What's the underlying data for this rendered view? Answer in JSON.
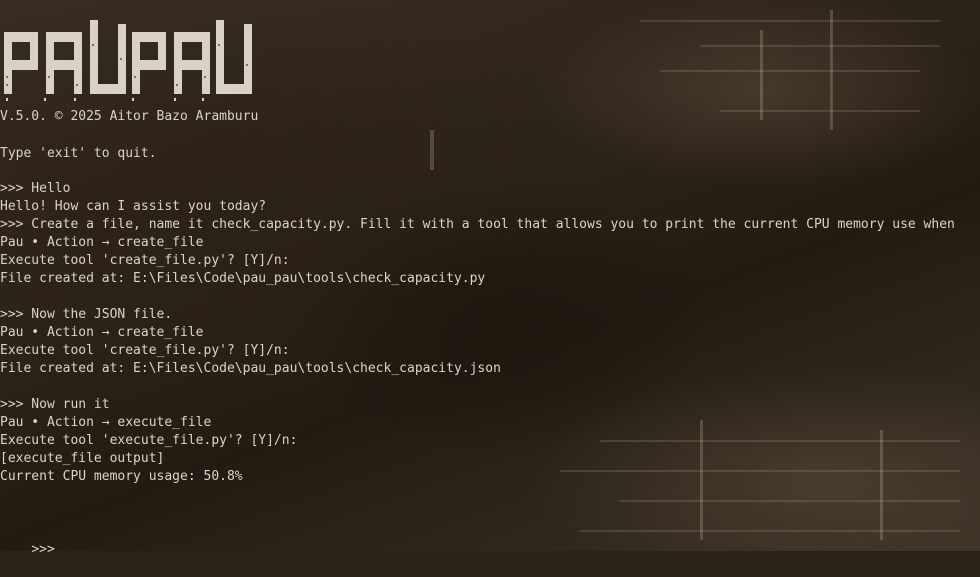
{
  "logo": {
    "text": "PAUPAU"
  },
  "version_line": "V.5.0. © 2025 Aitor Bazo Aramburu",
  "exit_hint": "Type 'exit' to quit.",
  "lines": [
    ">>> Hello",
    "Hello! How can I assist you today?",
    ">>> Create a file, name it check_capacity.py. Fill it with a tool that allows you to print the current CPU memory use when",
    "Pau • Action → create_file",
    "Execute tool 'create_file.py'? [Y]/n:",
    "File created at: E:\\Files\\Code\\pau_pau\\tools\\check_capacity.py",
    "",
    ">>> Now the JSON file.",
    "Pau • Action → create_file",
    "Execute tool 'create_file.py'? [Y]/n:",
    "File created at: E:\\Files\\Code\\pau_pau\\tools\\check_capacity.json",
    "",
    ">>> Now run it",
    "Pau • Action → execute_file",
    "Execute tool 'execute_file.py'? [Y]/n:",
    "[execute_file output]",
    "Current CPU memory usage: 50.8%"
  ],
  "prompt": ">>>",
  "colors": {
    "text": "#d9d4c9",
    "logo": "#d8d2c6",
    "background": "#2b2218"
  }
}
